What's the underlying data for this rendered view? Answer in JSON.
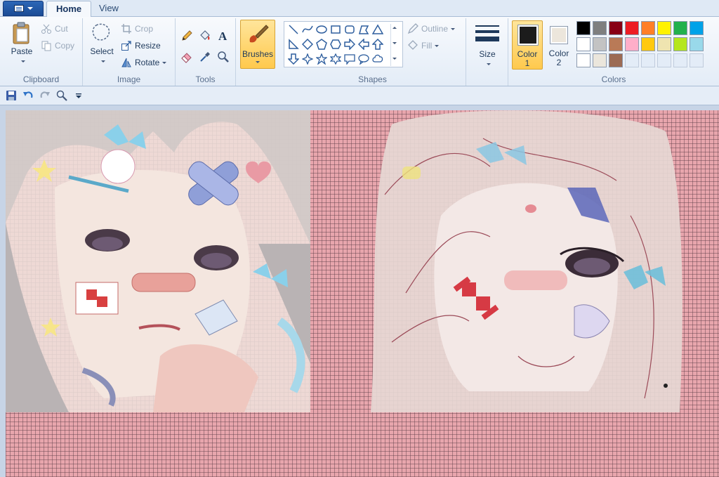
{
  "app_menu": {
    "icon": "document-menu-icon"
  },
  "tabs": [
    {
      "label": "Home",
      "active": true
    },
    {
      "label": "View",
      "active": false
    }
  ],
  "clipboard": {
    "paste": "Paste",
    "cut": "Cut",
    "copy": "Copy",
    "label": "Clipboard"
  },
  "image": {
    "select": "Select",
    "crop": "Crop",
    "resize": "Resize",
    "rotate": "Rotate",
    "label": "Image"
  },
  "tools": {
    "label": "Tools",
    "items": [
      "pencil-icon",
      "fill-bucket-icon",
      "text-icon",
      "eraser-icon",
      "color-picker-icon",
      "magnifier-icon"
    ]
  },
  "brushes": {
    "label": "Brushes"
  },
  "shapes": {
    "outline": "Outline",
    "fill": "Fill",
    "label": "Shapes"
  },
  "size": {
    "label": "Size"
  },
  "colors": {
    "color1_label": "Color",
    "color1_num": "1",
    "color2_label": "Color",
    "color2_num": "2",
    "label": "Colors",
    "color1": "#1c1c1c",
    "color2": "#ece6dc",
    "palette_row1": [
      "#000000",
      "#7f7f7f",
      "#880015",
      "#ed1c24",
      "#ff7f27",
      "#fff200",
      "#22b14c",
      "#00a2e8"
    ],
    "palette_row2": [
      "#ffffff",
      "#c3c3c3",
      "#b97a57",
      "#ffaec9",
      "#ffc90e",
      "#efe4b0",
      "#b5e61d",
      "#99d9ea"
    ],
    "palette_row3": [
      "#ffffff",
      "#ebe6dc",
      "#9c6b54"
    ]
  },
  "qat": [
    "save-icon",
    "undo-icon",
    "redo-icon",
    "zoom-icon",
    "customize-dropdown-icon"
  ],
  "canvas": {
    "background": "#e8a6ad"
  }
}
